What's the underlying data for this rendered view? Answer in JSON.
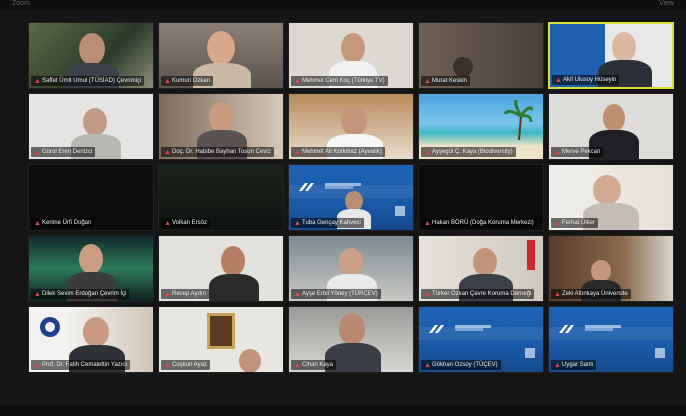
{
  "header": {
    "left_text": "Zoom",
    "right_text": "View"
  },
  "colors": {
    "accent_border": "#d7df3a",
    "mic_muted": "#e0474c"
  },
  "participants": [
    {
      "name": "Saffet Ümit Umul (TÜSİAD) Çevrimiçi"
    },
    {
      "name": "Kumuri Ozkan"
    },
    {
      "name": "Mehmet Cem Koç (Türkiye TV)"
    },
    {
      "name": "Murat Keskin"
    },
    {
      "name": "Akif Ulusoy Hüseyin"
    },
    {
      "name": "Gürol Eren Denizci"
    },
    {
      "name": "Doç. Dr. Habibe Bayhan Tosun Ceviz"
    },
    {
      "name": "Mehmet Ali Korkmaz (Ayvalık)"
    },
    {
      "name": "Ayşegül Ç. Kaya (Biodiversity)"
    },
    {
      "name": "Merve Pekcan"
    },
    {
      "name": "Kerime Ürfi Doğan"
    },
    {
      "name": "Volkan Ersöz"
    },
    {
      "name": "Tuba Gençay Kahveci"
    },
    {
      "name": "Hakan BÖRÜ (Doğa Koruma Merkezi)"
    },
    {
      "name": "Ferhat Ülker"
    },
    {
      "name": "Dilek Sevim Erdoğan Çevrim İçi"
    },
    {
      "name": "Recep Aydın"
    },
    {
      "name": "Ayşe Erbil Yöney (TÜRÇEV)"
    },
    {
      "name": "Türker Özkan Çevre Koruma Derneği"
    },
    {
      "name": "Zeki Altınkaya Üniversite"
    },
    {
      "name": "Prof. Dr. Fatih Cemalettin Yazıcı"
    },
    {
      "name": "Coşkun Ayaz"
    },
    {
      "name": "Cihan Kaya"
    },
    {
      "name": "Gökhan Ozsoy (TÜÇEV)"
    },
    {
      "name": "Uygar Sanlı"
    }
  ]
}
